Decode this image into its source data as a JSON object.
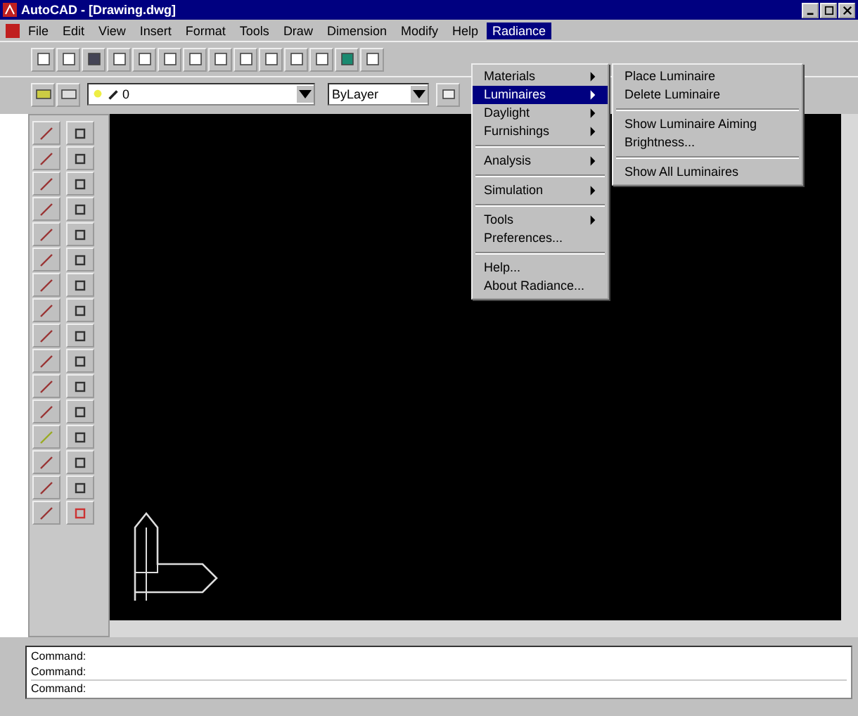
{
  "window": {
    "title": "AutoCAD - [Drawing.dwg]"
  },
  "menu_bar": [
    {
      "label": "File",
      "selected": false
    },
    {
      "label": "Edit",
      "selected": false
    },
    {
      "label": "View",
      "selected": false
    },
    {
      "label": "Insert",
      "selected": false
    },
    {
      "label": "Format",
      "selected": false
    },
    {
      "label": "Tools",
      "selected": false
    },
    {
      "label": "Draw",
      "selected": false
    },
    {
      "label": "Dimension",
      "selected": false
    },
    {
      "label": "Modify",
      "selected": false
    },
    {
      "label": "Help",
      "selected": false
    },
    {
      "label": "Radiance",
      "selected": true
    }
  ],
  "layer_field": {
    "value": "0"
  },
  "linetype_field": {
    "value": "ByLayer"
  },
  "radiance_menu": [
    {
      "kind": "item",
      "label": "Materials",
      "submenu": true,
      "selected": false
    },
    {
      "kind": "item",
      "label": "Luminaires",
      "submenu": true,
      "selected": true
    },
    {
      "kind": "item",
      "label": "Daylight",
      "submenu": true,
      "selected": false
    },
    {
      "kind": "item",
      "label": "Furnishings",
      "submenu": true,
      "selected": false
    },
    {
      "kind": "separator"
    },
    {
      "kind": "item",
      "label": "Analysis",
      "submenu": true,
      "selected": false
    },
    {
      "kind": "separator"
    },
    {
      "kind": "item",
      "label": "Simulation",
      "submenu": true,
      "selected": false
    },
    {
      "kind": "separator"
    },
    {
      "kind": "item",
      "label": "Tools",
      "submenu": true,
      "selected": false
    },
    {
      "kind": "item",
      "label": "Preferences...",
      "submenu": false,
      "selected": false
    },
    {
      "kind": "separator"
    },
    {
      "kind": "item",
      "label": "Help...",
      "submenu": false,
      "selected": false
    },
    {
      "kind": "item",
      "label": "About Radiance...",
      "submenu": false,
      "selected": false
    }
  ],
  "luminaires_submenu": [
    {
      "kind": "item",
      "label": "Place Luminaire"
    },
    {
      "kind": "item",
      "label": "Delete Luminaire"
    },
    {
      "kind": "separator"
    },
    {
      "kind": "item",
      "label": "Show Luminaire Aiming"
    },
    {
      "kind": "item",
      "label": "Brightness..."
    },
    {
      "kind": "separator"
    },
    {
      "kind": "item",
      "label": "Show All Luminaires"
    }
  ],
  "command_history": [
    "Command:",
    "Command:"
  ],
  "command_prompt": "Command:"
}
